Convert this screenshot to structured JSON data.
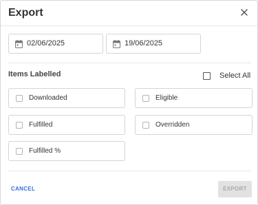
{
  "dialog": {
    "title": "Export",
    "close_icon": "close-icon"
  },
  "date_range": {
    "start": "02/06/2025",
    "end": "19/06/2025",
    "icon": "calendar-icon"
  },
  "items_labelled": {
    "title": "Items Labelled",
    "select_all_label": "Select All",
    "select_all_checked": false,
    "options": [
      {
        "label": "Downloaded",
        "checked": false
      },
      {
        "label": "Eligible",
        "checked": false
      },
      {
        "label": "Fulfilled",
        "checked": false
      },
      {
        "label": "Overridden",
        "checked": false
      },
      {
        "label": "Fulfilled %",
        "checked": false
      }
    ]
  },
  "footer": {
    "cancel_label": "CANCEL",
    "export_label": "EXPORT",
    "export_disabled": true
  },
  "colors": {
    "accent": "#3a6fd8",
    "disabled_bg": "#e2e2e2",
    "disabled_text": "#a8a8a8"
  }
}
